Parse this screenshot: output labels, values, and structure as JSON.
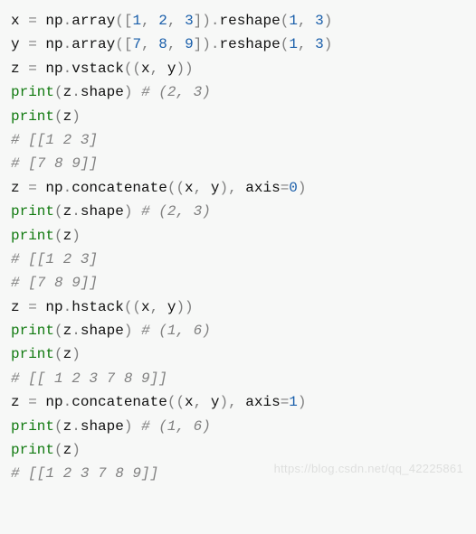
{
  "watermark": "https://blog.csdn.net/qq_42225861",
  "lines": [
    {
      "t": "code",
      "seg": [
        {
          "c": "id",
          "v": "x "
        },
        {
          "c": "op",
          "v": "= "
        },
        {
          "c": "id",
          "v": "np"
        },
        {
          "c": "op",
          "v": "."
        },
        {
          "c": "id",
          "v": "array"
        },
        {
          "c": "op",
          "v": "(["
        },
        {
          "c": "num",
          "v": "1"
        },
        {
          "c": "op",
          "v": ", "
        },
        {
          "c": "num",
          "v": "2"
        },
        {
          "c": "op",
          "v": ", "
        },
        {
          "c": "num",
          "v": "3"
        },
        {
          "c": "op",
          "v": "])."
        },
        {
          "c": "id",
          "v": "reshape"
        },
        {
          "c": "op",
          "v": "("
        },
        {
          "c": "num",
          "v": "1"
        },
        {
          "c": "op",
          "v": ", "
        },
        {
          "c": "num",
          "v": "3"
        },
        {
          "c": "op",
          "v": ")"
        }
      ]
    },
    {
      "t": "code",
      "seg": [
        {
          "c": "id",
          "v": "y "
        },
        {
          "c": "op",
          "v": "= "
        },
        {
          "c": "id",
          "v": "np"
        },
        {
          "c": "op",
          "v": "."
        },
        {
          "c": "id",
          "v": "array"
        },
        {
          "c": "op",
          "v": "(["
        },
        {
          "c": "num",
          "v": "7"
        },
        {
          "c": "op",
          "v": ", "
        },
        {
          "c": "num",
          "v": "8"
        },
        {
          "c": "op",
          "v": ", "
        },
        {
          "c": "num",
          "v": "9"
        },
        {
          "c": "op",
          "v": "])."
        },
        {
          "c": "id",
          "v": "reshape"
        },
        {
          "c": "op",
          "v": "("
        },
        {
          "c": "num",
          "v": "1"
        },
        {
          "c": "op",
          "v": ", "
        },
        {
          "c": "num",
          "v": "3"
        },
        {
          "c": "op",
          "v": ")"
        }
      ]
    },
    {
      "t": "code",
      "seg": [
        {
          "c": "id",
          "v": "z "
        },
        {
          "c": "op",
          "v": "= "
        },
        {
          "c": "id",
          "v": "np"
        },
        {
          "c": "op",
          "v": "."
        },
        {
          "c": "id",
          "v": "vstack"
        },
        {
          "c": "op",
          "v": "(("
        },
        {
          "c": "id",
          "v": "x"
        },
        {
          "c": "op",
          "v": ", "
        },
        {
          "c": "id",
          "v": "y"
        },
        {
          "c": "op",
          "v": "))"
        }
      ]
    },
    {
      "t": "code",
      "seg": [
        {
          "c": "fn",
          "v": "print"
        },
        {
          "c": "op",
          "v": "("
        },
        {
          "c": "id",
          "v": "z"
        },
        {
          "c": "op",
          "v": "."
        },
        {
          "c": "id",
          "v": "shape"
        },
        {
          "c": "op",
          "v": ") "
        },
        {
          "c": "cm",
          "v": "# (2, 3)"
        }
      ]
    },
    {
      "t": "code",
      "seg": [
        {
          "c": "fn",
          "v": "print"
        },
        {
          "c": "op",
          "v": "("
        },
        {
          "c": "id",
          "v": "z"
        },
        {
          "c": "op",
          "v": ")"
        }
      ]
    },
    {
      "t": "code",
      "seg": [
        {
          "c": "cm",
          "v": "# [[1 2 3]"
        }
      ]
    },
    {
      "t": "code",
      "seg": [
        {
          "c": "cm",
          "v": "# [7 8 9]]"
        }
      ]
    },
    {
      "t": "code",
      "seg": [
        {
          "c": "id",
          "v": "z "
        },
        {
          "c": "op",
          "v": "= "
        },
        {
          "c": "id",
          "v": "np"
        },
        {
          "c": "op",
          "v": "."
        },
        {
          "c": "id",
          "v": "concatenate"
        },
        {
          "c": "op",
          "v": "(("
        },
        {
          "c": "id",
          "v": "x"
        },
        {
          "c": "op",
          "v": ", "
        },
        {
          "c": "id",
          "v": "y"
        },
        {
          "c": "op",
          "v": "), "
        },
        {
          "c": "id",
          "v": "axis"
        },
        {
          "c": "op",
          "v": "="
        },
        {
          "c": "num",
          "v": "0"
        },
        {
          "c": "op",
          "v": ")"
        }
      ]
    },
    {
      "t": "code",
      "seg": [
        {
          "c": "fn",
          "v": "print"
        },
        {
          "c": "op",
          "v": "("
        },
        {
          "c": "id",
          "v": "z"
        },
        {
          "c": "op",
          "v": "."
        },
        {
          "c": "id",
          "v": "shape"
        },
        {
          "c": "op",
          "v": ") "
        },
        {
          "c": "cm",
          "v": "# (2, 3)"
        }
      ]
    },
    {
      "t": "code",
      "seg": [
        {
          "c": "fn",
          "v": "print"
        },
        {
          "c": "op",
          "v": "("
        },
        {
          "c": "id",
          "v": "z"
        },
        {
          "c": "op",
          "v": ")"
        }
      ]
    },
    {
      "t": "code",
      "seg": [
        {
          "c": "cm",
          "v": "# [[1 2 3]"
        }
      ]
    },
    {
      "t": "code",
      "seg": [
        {
          "c": "cm",
          "v": "# [7 8 9]]"
        }
      ]
    },
    {
      "t": "code",
      "seg": [
        {
          "c": "id",
          "v": "z "
        },
        {
          "c": "op",
          "v": "= "
        },
        {
          "c": "id",
          "v": "np"
        },
        {
          "c": "op",
          "v": "."
        },
        {
          "c": "id",
          "v": "hstack"
        },
        {
          "c": "op",
          "v": "(("
        },
        {
          "c": "id",
          "v": "x"
        },
        {
          "c": "op",
          "v": ", "
        },
        {
          "c": "id",
          "v": "y"
        },
        {
          "c": "op",
          "v": "))"
        }
      ]
    },
    {
      "t": "code",
      "seg": [
        {
          "c": "fn",
          "v": "print"
        },
        {
          "c": "op",
          "v": "("
        },
        {
          "c": "id",
          "v": "z"
        },
        {
          "c": "op",
          "v": "."
        },
        {
          "c": "id",
          "v": "shape"
        },
        {
          "c": "op",
          "v": ") "
        },
        {
          "c": "cm",
          "v": "# (1, 6)"
        }
      ]
    },
    {
      "t": "code",
      "seg": [
        {
          "c": "fn",
          "v": "print"
        },
        {
          "c": "op",
          "v": "("
        },
        {
          "c": "id",
          "v": "z"
        },
        {
          "c": "op",
          "v": ")"
        }
      ]
    },
    {
      "t": "code",
      "seg": [
        {
          "c": "cm",
          "v": "# [[ 1 2 3 7 8 9]]"
        }
      ]
    },
    {
      "t": "code",
      "seg": [
        {
          "c": "id",
          "v": "z "
        },
        {
          "c": "op",
          "v": "= "
        },
        {
          "c": "id",
          "v": "np"
        },
        {
          "c": "op",
          "v": "."
        },
        {
          "c": "id",
          "v": "concatenate"
        },
        {
          "c": "op",
          "v": "(("
        },
        {
          "c": "id",
          "v": "x"
        },
        {
          "c": "op",
          "v": ", "
        },
        {
          "c": "id",
          "v": "y"
        },
        {
          "c": "op",
          "v": "), "
        },
        {
          "c": "id",
          "v": "axis"
        },
        {
          "c": "op",
          "v": "="
        },
        {
          "c": "num",
          "v": "1"
        },
        {
          "c": "op",
          "v": ")"
        }
      ]
    },
    {
      "t": "code",
      "seg": [
        {
          "c": "fn",
          "v": "print"
        },
        {
          "c": "op",
          "v": "("
        },
        {
          "c": "id",
          "v": "z"
        },
        {
          "c": "op",
          "v": "."
        },
        {
          "c": "id",
          "v": "shape"
        },
        {
          "c": "op",
          "v": ") "
        },
        {
          "c": "cm",
          "v": "# (1, 6)"
        }
      ]
    },
    {
      "t": "code",
      "seg": [
        {
          "c": "fn",
          "v": "print"
        },
        {
          "c": "op",
          "v": "("
        },
        {
          "c": "id",
          "v": "z"
        },
        {
          "c": "op",
          "v": ")"
        }
      ]
    },
    {
      "t": "code",
      "seg": [
        {
          "c": "cm",
          "v": "# [[1 2 3 7 8 9]]"
        }
      ]
    }
  ]
}
